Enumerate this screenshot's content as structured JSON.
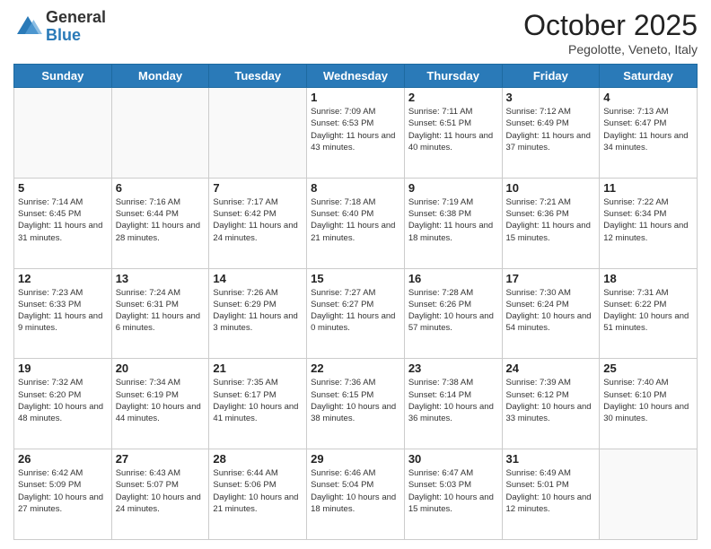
{
  "header": {
    "logo_general": "General",
    "logo_blue": "Blue",
    "month_title": "October 2025",
    "location": "Pegolotte, Veneto, Italy"
  },
  "weekdays": [
    "Sunday",
    "Monday",
    "Tuesday",
    "Wednesday",
    "Thursday",
    "Friday",
    "Saturday"
  ],
  "weeks": [
    [
      {
        "day": "",
        "sunrise": "",
        "sunset": "",
        "daylight": ""
      },
      {
        "day": "",
        "sunrise": "",
        "sunset": "",
        "daylight": ""
      },
      {
        "day": "",
        "sunrise": "",
        "sunset": "",
        "daylight": ""
      },
      {
        "day": "1",
        "sunrise": "7:09 AM",
        "sunset": "6:53 PM",
        "daylight": "11 hours and 43 minutes."
      },
      {
        "day": "2",
        "sunrise": "7:11 AM",
        "sunset": "6:51 PM",
        "daylight": "11 hours and 40 minutes."
      },
      {
        "day": "3",
        "sunrise": "7:12 AM",
        "sunset": "6:49 PM",
        "daylight": "11 hours and 37 minutes."
      },
      {
        "day": "4",
        "sunrise": "7:13 AM",
        "sunset": "6:47 PM",
        "daylight": "11 hours and 34 minutes."
      }
    ],
    [
      {
        "day": "5",
        "sunrise": "7:14 AM",
        "sunset": "6:45 PM",
        "daylight": "11 hours and 31 minutes."
      },
      {
        "day": "6",
        "sunrise": "7:16 AM",
        "sunset": "6:44 PM",
        "daylight": "11 hours and 28 minutes."
      },
      {
        "day": "7",
        "sunrise": "7:17 AM",
        "sunset": "6:42 PM",
        "daylight": "11 hours and 24 minutes."
      },
      {
        "day": "8",
        "sunrise": "7:18 AM",
        "sunset": "6:40 PM",
        "daylight": "11 hours and 21 minutes."
      },
      {
        "day": "9",
        "sunrise": "7:19 AM",
        "sunset": "6:38 PM",
        "daylight": "11 hours and 18 minutes."
      },
      {
        "day": "10",
        "sunrise": "7:21 AM",
        "sunset": "6:36 PM",
        "daylight": "11 hours and 15 minutes."
      },
      {
        "day": "11",
        "sunrise": "7:22 AM",
        "sunset": "6:34 PM",
        "daylight": "11 hours and 12 minutes."
      }
    ],
    [
      {
        "day": "12",
        "sunrise": "7:23 AM",
        "sunset": "6:33 PM",
        "daylight": "11 hours and 9 minutes."
      },
      {
        "day": "13",
        "sunrise": "7:24 AM",
        "sunset": "6:31 PM",
        "daylight": "11 hours and 6 minutes."
      },
      {
        "day": "14",
        "sunrise": "7:26 AM",
        "sunset": "6:29 PM",
        "daylight": "11 hours and 3 minutes."
      },
      {
        "day": "15",
        "sunrise": "7:27 AM",
        "sunset": "6:27 PM",
        "daylight": "11 hours and 0 minutes."
      },
      {
        "day": "16",
        "sunrise": "7:28 AM",
        "sunset": "6:26 PM",
        "daylight": "10 hours and 57 minutes."
      },
      {
        "day": "17",
        "sunrise": "7:30 AM",
        "sunset": "6:24 PM",
        "daylight": "10 hours and 54 minutes."
      },
      {
        "day": "18",
        "sunrise": "7:31 AM",
        "sunset": "6:22 PM",
        "daylight": "10 hours and 51 minutes."
      }
    ],
    [
      {
        "day": "19",
        "sunrise": "7:32 AM",
        "sunset": "6:20 PM",
        "daylight": "10 hours and 48 minutes."
      },
      {
        "day": "20",
        "sunrise": "7:34 AM",
        "sunset": "6:19 PM",
        "daylight": "10 hours and 44 minutes."
      },
      {
        "day": "21",
        "sunrise": "7:35 AM",
        "sunset": "6:17 PM",
        "daylight": "10 hours and 41 minutes."
      },
      {
        "day": "22",
        "sunrise": "7:36 AM",
        "sunset": "6:15 PM",
        "daylight": "10 hours and 38 minutes."
      },
      {
        "day": "23",
        "sunrise": "7:38 AM",
        "sunset": "6:14 PM",
        "daylight": "10 hours and 36 minutes."
      },
      {
        "day": "24",
        "sunrise": "7:39 AM",
        "sunset": "6:12 PM",
        "daylight": "10 hours and 33 minutes."
      },
      {
        "day": "25",
        "sunrise": "7:40 AM",
        "sunset": "6:10 PM",
        "daylight": "10 hours and 30 minutes."
      }
    ],
    [
      {
        "day": "26",
        "sunrise": "6:42 AM",
        "sunset": "5:09 PM",
        "daylight": "10 hours and 27 minutes."
      },
      {
        "day": "27",
        "sunrise": "6:43 AM",
        "sunset": "5:07 PM",
        "daylight": "10 hours and 24 minutes."
      },
      {
        "day": "28",
        "sunrise": "6:44 AM",
        "sunset": "5:06 PM",
        "daylight": "10 hours and 21 minutes."
      },
      {
        "day": "29",
        "sunrise": "6:46 AM",
        "sunset": "5:04 PM",
        "daylight": "10 hours and 18 minutes."
      },
      {
        "day": "30",
        "sunrise": "6:47 AM",
        "sunset": "5:03 PM",
        "daylight": "10 hours and 15 minutes."
      },
      {
        "day": "31",
        "sunrise": "6:49 AM",
        "sunset": "5:01 PM",
        "daylight": "10 hours and 12 minutes."
      },
      {
        "day": "",
        "sunrise": "",
        "sunset": "",
        "daylight": ""
      }
    ]
  ]
}
